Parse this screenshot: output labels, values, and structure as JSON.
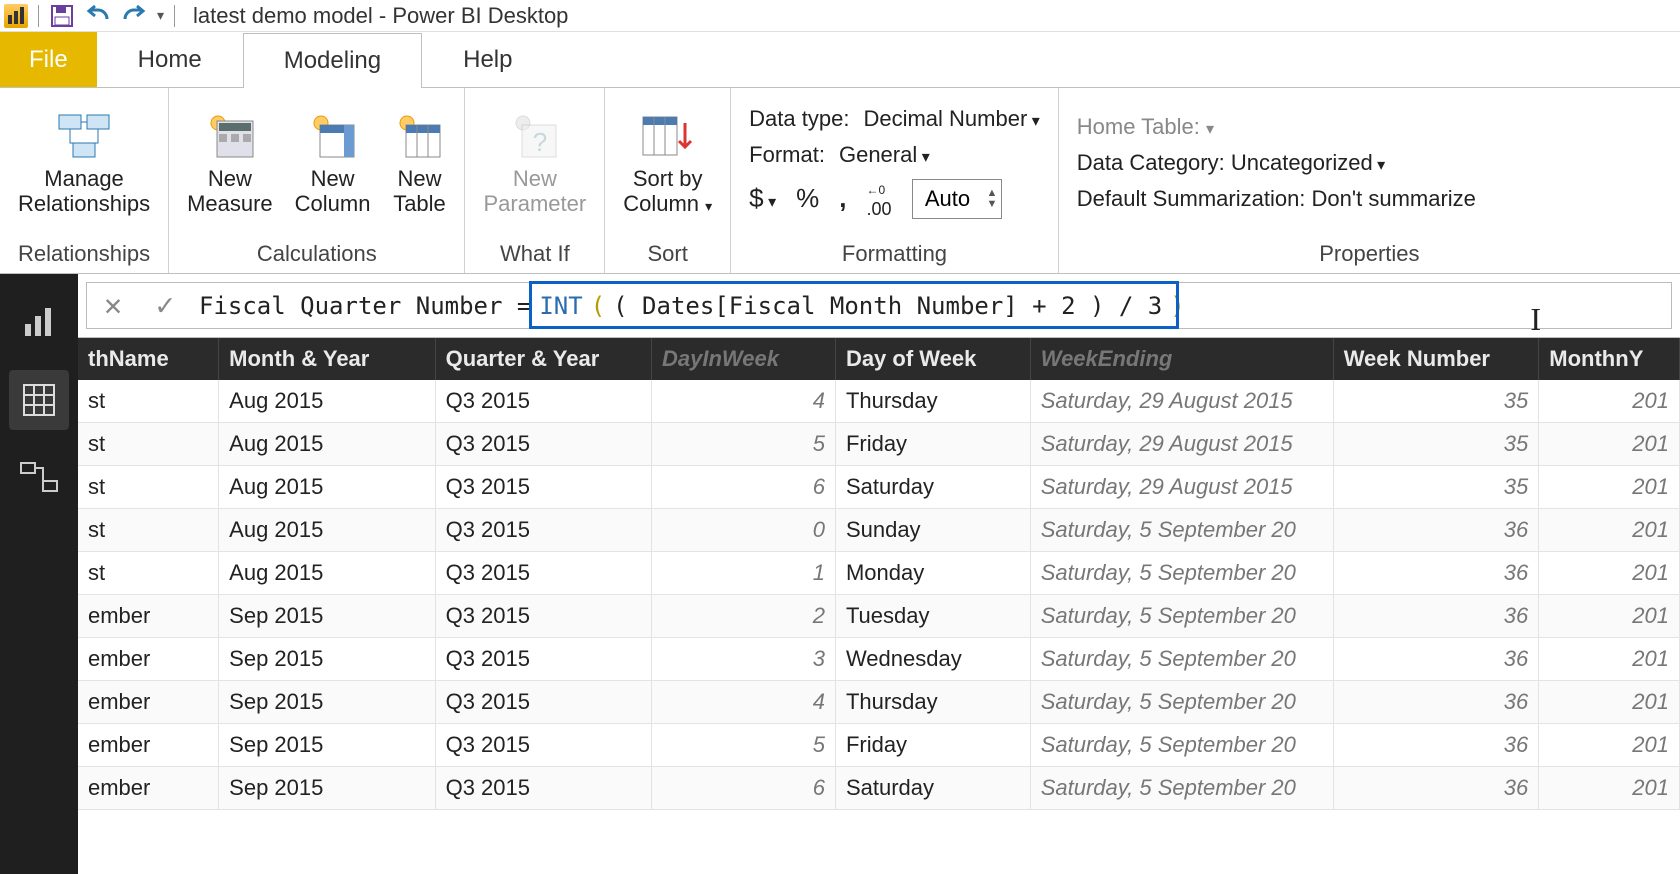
{
  "window": {
    "title": "latest demo model - Power BI Desktop"
  },
  "tabs": {
    "file": "File",
    "home": "Home",
    "modeling": "Modeling",
    "help": "Help"
  },
  "ribbon": {
    "relationships": {
      "manage": "Manage\nRelationships",
      "group": "Relationships"
    },
    "calc": {
      "measure": "New\nMeasure",
      "column": "New\nColumn",
      "table": "New\nTable",
      "group": "Calculations"
    },
    "whatif": {
      "param": "New\nParameter",
      "group": "What If"
    },
    "sort": {
      "sort": "Sort by\nColumn",
      "group": "Sort"
    },
    "fmt": {
      "datatype_label": "Data type:",
      "datatype_value": "Decimal Number",
      "format_label": "Format:",
      "format_value": "General",
      "currency": "$",
      "percent": "%",
      "comma": ",",
      "decimals_icon": ".00",
      "decimals_value": "Auto",
      "group": "Formatting"
    },
    "prop": {
      "hometable_label": "Home Table:",
      "category_label": "Data Category:",
      "category_value": "Uncategorized",
      "summ_label": "Default Summarization:",
      "summ_value": "Don't summarize",
      "group": "Properties"
    }
  },
  "formula": {
    "lhs": "Fiscal Quarter Number =",
    "fn": "INT",
    "body": "( Dates[Fiscal Month Number] + 2 ) / 3"
  },
  "columns": [
    "thName",
    "Month & Year",
    "Quarter & Year",
    "DayInWeek",
    "Day of Week",
    "WeekEnding",
    "Week Number",
    "MonthnY"
  ],
  "rows": [
    {
      "thName": "st",
      "my": "Aug 2015",
      "qy": "Q3 2015",
      "diw": "4",
      "dow": "Thursday",
      "we": "Saturday, 29 August 2015",
      "wn": "35",
      "mny": "201"
    },
    {
      "thName": "st",
      "my": "Aug 2015",
      "qy": "Q3 2015",
      "diw": "5",
      "dow": "Friday",
      "we": "Saturday, 29 August 2015",
      "wn": "35",
      "mny": "201"
    },
    {
      "thName": "st",
      "my": "Aug 2015",
      "qy": "Q3 2015",
      "diw": "6",
      "dow": "Saturday",
      "we": "Saturday, 29 August 2015",
      "wn": "35",
      "mny": "201"
    },
    {
      "thName": "st",
      "my": "Aug 2015",
      "qy": "Q3 2015",
      "diw": "0",
      "dow": "Sunday",
      "we": "Saturday, 5 September 20",
      "wn": "36",
      "mny": "201"
    },
    {
      "thName": "st",
      "my": "Aug 2015",
      "qy": "Q3 2015",
      "diw": "1",
      "dow": "Monday",
      "we": "Saturday, 5 September 20",
      "wn": "36",
      "mny": "201"
    },
    {
      "thName": "ember",
      "my": "Sep 2015",
      "qy": "Q3 2015",
      "diw": "2",
      "dow": "Tuesday",
      "we": "Saturday, 5 September 20",
      "wn": "36",
      "mny": "201"
    },
    {
      "thName": "ember",
      "my": "Sep 2015",
      "qy": "Q3 2015",
      "diw": "3",
      "dow": "Wednesday",
      "we": "Saturday, 5 September 20",
      "wn": "36",
      "mny": "201"
    },
    {
      "thName": "ember",
      "my": "Sep 2015",
      "qy": "Q3 2015",
      "diw": "4",
      "dow": "Thursday",
      "we": "Saturday, 5 September 20",
      "wn": "36",
      "mny": "201"
    },
    {
      "thName": "ember",
      "my": "Sep 2015",
      "qy": "Q3 2015",
      "diw": "5",
      "dow": "Friday",
      "we": "Saturday, 5 September 20",
      "wn": "36",
      "mny": "201"
    },
    {
      "thName": "ember",
      "my": "Sep 2015",
      "qy": "Q3 2015",
      "diw": "6",
      "dow": "Saturday",
      "we": "Saturday, 5 September 20",
      "wn": "36",
      "mny": "201"
    }
  ]
}
